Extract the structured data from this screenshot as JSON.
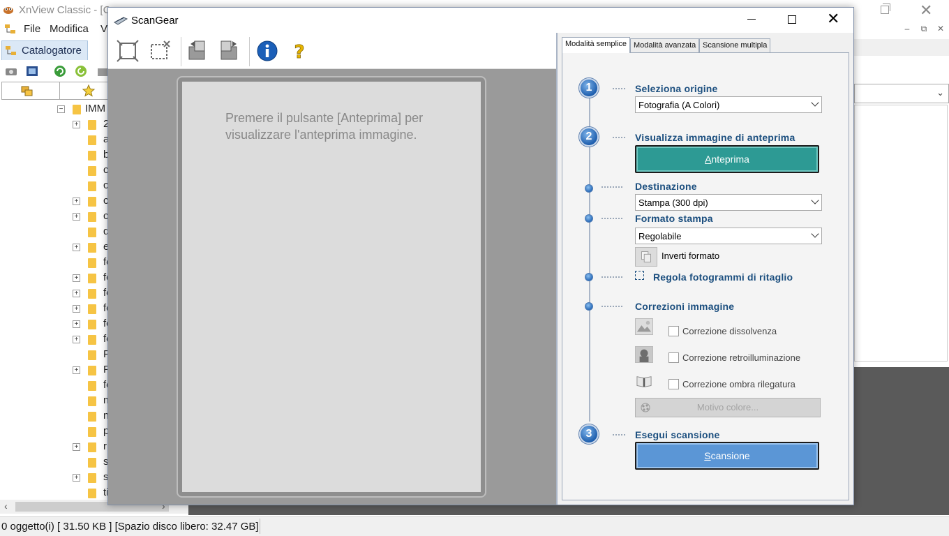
{
  "xnview": {
    "title": "XnView Classic - [C",
    "menu": [
      "File",
      "Modifica",
      "V"
    ],
    "tab_catalog": "Catalogatore",
    "tree_root": "IMM",
    "tree_items": [
      "2",
      "a",
      "b",
      "c",
      "c",
      "c",
      "c",
      "d",
      "e",
      "fo",
      "fo",
      "fo",
      "fo",
      "fo",
      "fo",
      "F",
      "F",
      "fo",
      "m",
      "m",
      "p",
      "r",
      "s",
      "s",
      "ti"
    ],
    "status": "0 oggetto(i) [ 31.50 KB ] [Spazio disco libero: 32.47 GB]"
  },
  "scangear": {
    "title": "ScanGear",
    "preview_hint": "Premere il pulsante [Anteprima] per visualizzare l'anteprima immagine.",
    "tabs": [
      "Modalità semplice",
      "Modalità avanzata",
      "Scansione multipla"
    ],
    "steps": {
      "step1_num": "1",
      "step1_label": "Seleziona origine",
      "source_value": "Fotografia (A Colori)",
      "step2_num": "2",
      "step2_label": "Visualizza immagine di anteprima",
      "preview_btn_u": "A",
      "preview_btn_rest": "nteprima",
      "destination_label": "Destinazione",
      "destination_value": "Stampa (300 dpi)",
      "print_size_label": "Formato stampa",
      "print_size_value": "Regolabile",
      "invert_label": "Inverti formato",
      "crop_label": "Regola fotogrammi di ritaglio",
      "corrections_label": "Correzioni immagine",
      "corr_fade": "Correzione dissolvenza",
      "corr_backlight": "Correzione retroilluminazione",
      "corr_gutter": "Correzione ombra rilegatura",
      "color_pattern": "Motivo colore...",
      "step3_num": "3",
      "step3_label": "Esegui scansione",
      "scan_btn_u": "S",
      "scan_btn_rest": "cansione"
    }
  },
  "colors": {
    "preview_button": "#2d9a94",
    "scan_button": "#5b96d6",
    "section_label": "#1c4f7f",
    "folder": "#f6c444"
  },
  "icons": [
    "app-icon",
    "catalog-icon",
    "folder-icon",
    "scanner-icon",
    "fit-select-icon",
    "clear-select-icon",
    "rotate-left-icon",
    "rotate-right-icon",
    "info-icon",
    "help-icon",
    "invert-icon",
    "crop-frame-icon",
    "color-pattern-icon"
  ]
}
